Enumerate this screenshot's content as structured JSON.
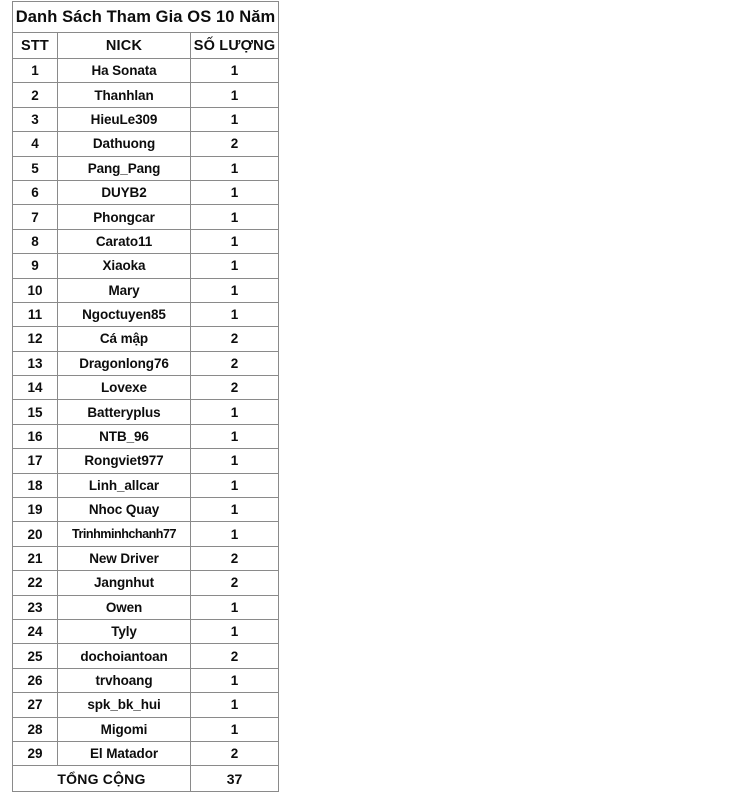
{
  "document": {
    "title": "Danh Sách Tham Gia OS 10 Năm",
    "title_color": "#bf4340",
    "table": {
      "columns": [
        "STT",
        "NICK",
        "SỐ LƯỢNG"
      ],
      "rows": [
        {
          "stt": "1",
          "nick": "Ha Sonata",
          "qty": "1"
        },
        {
          "stt": "2",
          "nick": "Thanhlan",
          "qty": "1"
        },
        {
          "stt": "3",
          "nick": "HieuLe309",
          "qty": "1"
        },
        {
          "stt": "4",
          "nick": "Dathuong",
          "qty": "2"
        },
        {
          "stt": "5",
          "nick": "Pang_Pang",
          "qty": "1"
        },
        {
          "stt": "6",
          "nick": "DUYB2",
          "qty": "1"
        },
        {
          "stt": "7",
          "nick": "Phongcar",
          "qty": "1"
        },
        {
          "stt": "8",
          "nick": "Carato11",
          "qty": "1"
        },
        {
          "stt": "9",
          "nick": "Xiaoka",
          "qty": "1"
        },
        {
          "stt": "10",
          "nick": "Mary",
          "qty": "1"
        },
        {
          "stt": "11",
          "nick": "Ngoctuyen85",
          "qty": "1"
        },
        {
          "stt": "12",
          "nick": "Cá mập",
          "qty": "2"
        },
        {
          "stt": "13",
          "nick": "Dragonlong76",
          "qty": "2"
        },
        {
          "stt": "14",
          "nick": "Lovexe",
          "qty": "2"
        },
        {
          "stt": "15",
          "nick": "Batteryplus",
          "qty": "1"
        },
        {
          "stt": "16",
          "nick": "NTB_96",
          "qty": "1"
        },
        {
          "stt": "17",
          "nick": "Rongviet977",
          "qty": "1"
        },
        {
          "stt": "18",
          "nick": "Linh_allcar",
          "qty": "1"
        },
        {
          "stt": "19",
          "nick": "Nhoc Quay",
          "qty": "1"
        },
        {
          "stt": "20",
          "nick": "Trinhminhchanh77",
          "qty": "1"
        },
        {
          "stt": "21",
          "nick": "New Driver",
          "qty": "2"
        },
        {
          "stt": "22",
          "nick": "Jangnhut",
          "qty": "2"
        },
        {
          "stt": "23",
          "nick": "Owen",
          "qty": "1"
        },
        {
          "stt": "24",
          "nick": "Tyly",
          "qty": "1"
        },
        {
          "stt": "25",
          "nick": "dochoiantoan",
          "qty": "2"
        },
        {
          "stt": "26",
          "nick": "trvhoang",
          "qty": "1"
        },
        {
          "stt": "27",
          "nick": "spk_bk_hui",
          "qty": "1"
        },
        {
          "stt": "28",
          "nick": "Migomi",
          "qty": "1"
        },
        {
          "stt": "29",
          "nick": "El Matador",
          "qty": "2"
        }
      ],
      "total_label": "TỔNG CỘNG",
      "total_value": "37"
    }
  }
}
